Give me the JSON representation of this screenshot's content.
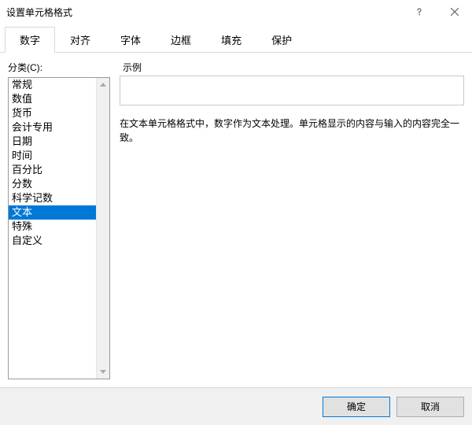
{
  "window": {
    "title": "设置单元格格式"
  },
  "tabs": [
    {
      "label": "数字",
      "active": true
    },
    {
      "label": "对齐",
      "active": false
    },
    {
      "label": "字体",
      "active": false
    },
    {
      "label": "边框",
      "active": false
    },
    {
      "label": "填充",
      "active": false
    },
    {
      "label": "保护",
      "active": false
    }
  ],
  "category": {
    "label": "分类(C):",
    "items": [
      "常规",
      "数值",
      "货币",
      "会计专用",
      "日期",
      "时间",
      "百分比",
      "分数",
      "科学记数",
      "文本",
      "特殊",
      "自定义"
    ],
    "selected_index": 9
  },
  "sample": {
    "label": "示例",
    "value": ""
  },
  "description": "在文本单元格格式中，数字作为文本处理。单元格显示的内容与输入的内容完全一致。",
  "buttons": {
    "ok": "确定",
    "cancel": "取消"
  }
}
